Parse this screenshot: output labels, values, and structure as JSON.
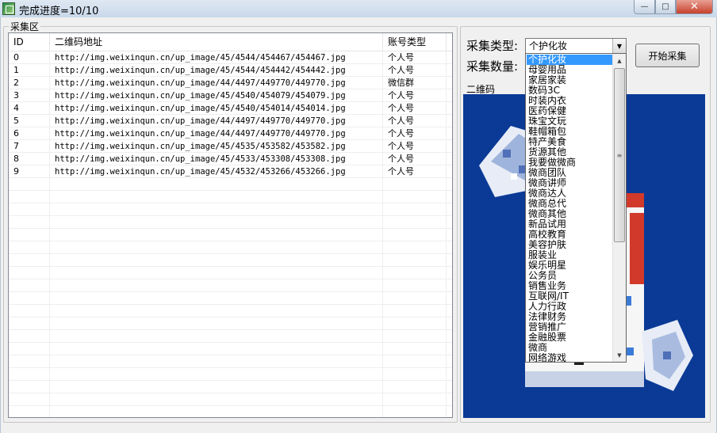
{
  "window": {
    "title": "完成进度=10/10",
    "minimize_glyph": "—",
    "maximize_glyph": "□",
    "close_glyph": "✕"
  },
  "collect_area": {
    "label": "采集区",
    "columns": [
      "ID",
      "二维码地址",
      "账号类型"
    ],
    "rows": [
      {
        "id": "0",
        "url": "http://img.weixinqun.cn/up_image/45/4544/454467/454467.jpg",
        "type": "个人号"
      },
      {
        "id": "1",
        "url": "http://img.weixinqun.cn/up_image/45/4544/454442/454442.jpg",
        "type": "个人号"
      },
      {
        "id": "2",
        "url": "http://img.weixinqun.cn/up_image/44/4497/449770/449770.jpg",
        "type": "微信群"
      },
      {
        "id": "3",
        "url": "http://img.weixinqun.cn/up_image/45/4540/454079/454079.jpg",
        "type": "个人号"
      },
      {
        "id": "4",
        "url": "http://img.weixinqun.cn/up_image/45/4540/454014/454014.jpg",
        "type": "个人号"
      },
      {
        "id": "5",
        "url": "http://img.weixinqun.cn/up_image/44/4497/449770/449770.jpg",
        "type": "个人号"
      },
      {
        "id": "6",
        "url": "http://img.weixinqun.cn/up_image/44/4497/449770/449770.jpg",
        "type": "个人号"
      },
      {
        "id": "7",
        "url": "http://img.weixinqun.cn/up_image/45/4535/453582/453582.jpg",
        "type": "个人号"
      },
      {
        "id": "8",
        "url": "http://img.weixinqun.cn/up_image/45/4533/453308/453308.jpg",
        "type": "个人号"
      },
      {
        "id": "9",
        "url": "http://img.weixinqun.cn/up_image/45/4532/453266/453266.jpg",
        "type": "个人号"
      }
    ]
  },
  "settings": {
    "type_label": "采集类型:",
    "count_label": "采集数量:",
    "selected_type": "个护化妆",
    "start_button": "开始采集"
  },
  "qr_panel": {
    "label": "二维码"
  },
  "dropdown_options": [
    "个护化妆",
    "母婴用品",
    "家居家装",
    "数码3C",
    "时装内衣",
    "医药保健",
    "珠宝文玩",
    "鞋帽箱包",
    "特产美食",
    "货源其他",
    "我要做微商",
    "微商团队",
    "微商讲师",
    "微商达人",
    "微商总代",
    "微商其他",
    "新品试用",
    "高校教育",
    "美容护肤",
    "服装业",
    "娱乐明星",
    "公务员",
    "销售业务",
    "互联网/IT",
    "人力行政",
    "法律财务",
    "营销推广",
    "金融股票",
    "微商",
    "网络游戏"
  ],
  "colors": {
    "selection": "#3399ff",
    "qr_background": "#0a3a96"
  }
}
